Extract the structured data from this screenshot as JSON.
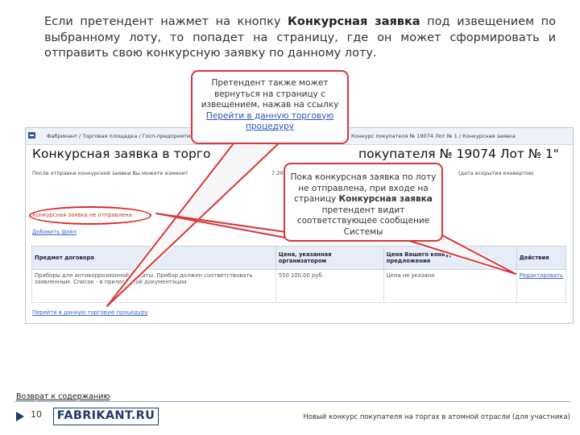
{
  "intro": {
    "part1": "Если претендент нажмет на кнопку ",
    "bold": "Конкурсная заявка",
    "part2": " под извещением по выбранному лоту, то попадет на страницу, где он может сформировать и отправить свою конкурсную заявку по данному лоту."
  },
  "screenshot": {
    "breadcrumb_left": "Фабрикант / Торговая площадка / Госп-предприятий отр",
    "breadcrumb_right": "Конкурс покупателя № 19074 Лот № 1 / Конкурсная заявка",
    "title_left": "Конкурсная заявка в торго",
    "title_right": "покупателя № 19074 Лот № 1\"",
    "note_p1": "После отправки конкурсной заявки Вы можете изменит",
    "note_p2": "7.2011 в 10:",
    "note_p3": "(дата вскрытия конвертов)",
    "bid_status": "Конкурсная заявка не отправлена",
    "add_file": "Добавить файл",
    "table": {
      "headers": [
        "Предмет договора",
        "Цена, указанная организатором",
        "Цена Вашего конкурсного предложения",
        "Действия"
      ],
      "row": [
        "Приборы для антикоррозионной защиты. Прибор должен соответствовать заявленным. Список - в прилагаемой документации",
        "550 100,00 руб.",
        "Цена не указана",
        "Редактировать"
      ]
    },
    "back_link": "Перейти в данную торговую процедуру"
  },
  "callout1": {
    "text": "Претендент также может вернуться на страницу с извещением, нажав на ссылку ",
    "link": "Перейти в данную торговую процедуру"
  },
  "callout2": {
    "text1": "Пока конкурсная заявка по лоту не отправлена, при входе на страницу ",
    "bold": "Конкурсная заявка",
    "text2": " претендент видит соответствующее сообщение Системы"
  },
  "footer": {
    "back_toc": "Возврат к содержанию",
    "page_number": "10",
    "logo": "FABRIKANT.RU",
    "caption": "Новый конкурс покупателя на торгах в атомной отрасли (для участника)"
  },
  "colors": {
    "callout_border": "#d9363e",
    "link": "#3a66c4",
    "logo": "#1f3c69"
  }
}
